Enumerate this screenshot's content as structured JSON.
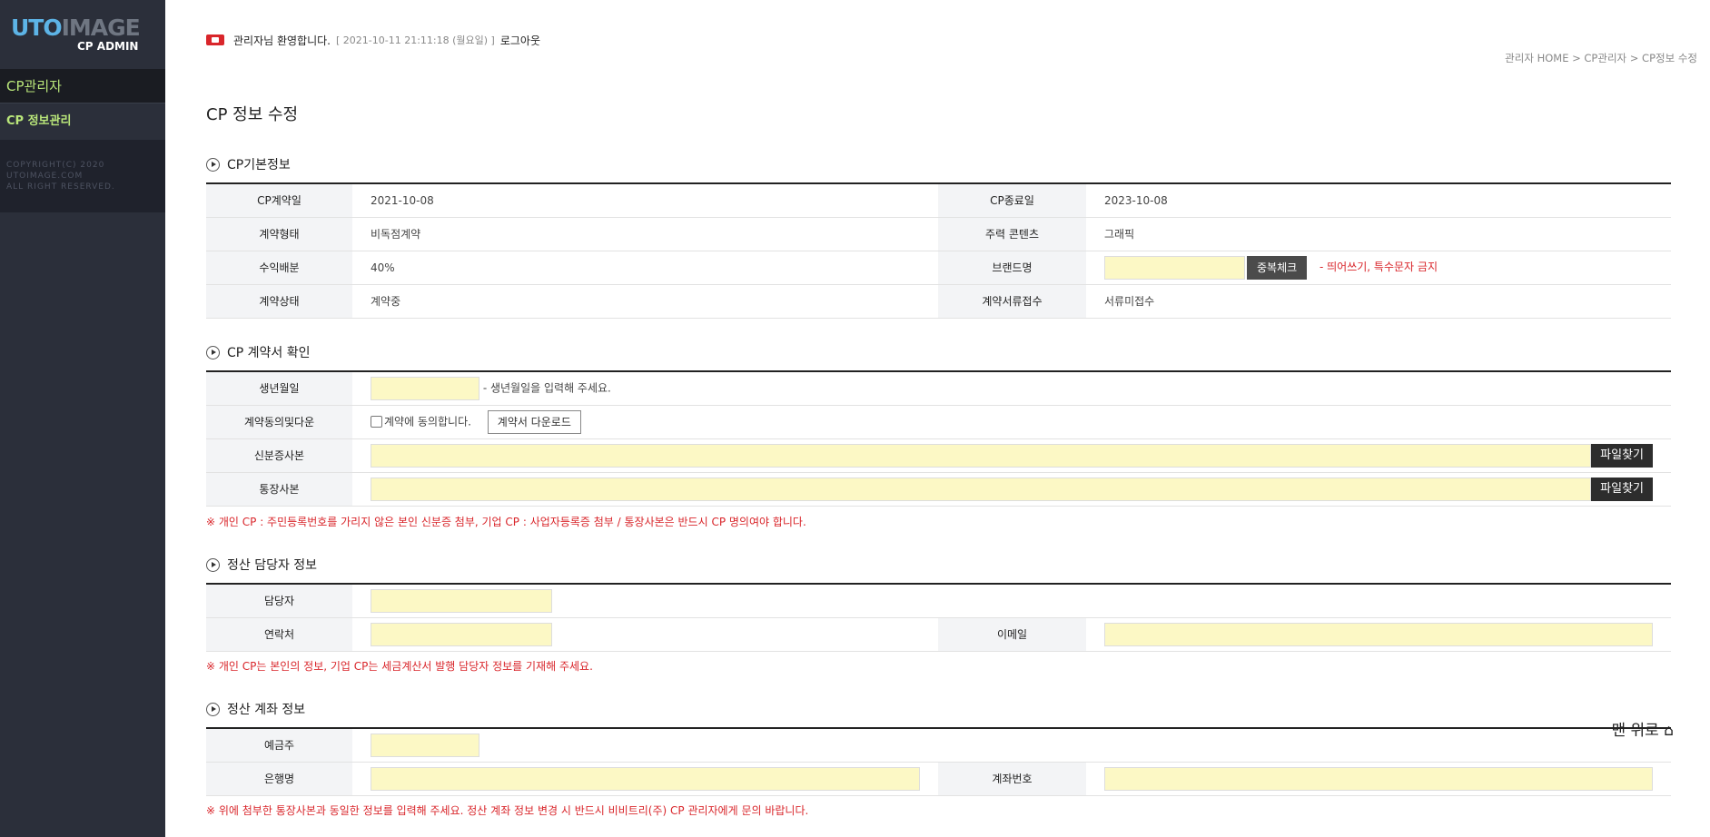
{
  "sidebar": {
    "logo_uto": "UTO",
    "logo_image": "IMAGE",
    "logo_sub": "CP ADMIN",
    "menu_head": "CP관리자",
    "menu_item": "CP 정보관리",
    "copyright_1": "COPYRIGHT(C) 2020",
    "copyright_2": "UTOIMAGE.COM",
    "copyright_3": "ALL RIGHT RESERVED."
  },
  "header": {
    "welcome": "관리자님 환영합니다.",
    "datetime": "[ 2021-10-11 21:11:18 (월요일) ]",
    "logout": "로그아웃",
    "breadcrumb": "관리자 HOME > CP관리자 > CP정보 수정",
    "page_title": "CP 정보 수정"
  },
  "basic": {
    "title": "CP기본정보",
    "contract_date_label": "CP계약일",
    "contract_date": "2021-10-08",
    "end_date_label": "CP종료일",
    "end_date": "2023-10-08",
    "contract_type_label": "계약형태",
    "contract_type": "비독점계약",
    "main_content_label": "주력 콘텐츠",
    "main_content": "그래픽",
    "revenue_label": "수익배분",
    "revenue": "40%",
    "brand_label": "브랜드명",
    "brand_value": "",
    "dup_check": "중복체크",
    "brand_note": "- 띄어쓰기, 특수문자 금지",
    "status_label": "계약상태",
    "status": "계약중",
    "docs_label": "계약서류접수",
    "docs_status": "서류미접수"
  },
  "contract": {
    "title": "CP 계약서 확인",
    "birth_label": "생년월일",
    "birth_value": "",
    "birth_hint": "- 생년월일을 입력해 주세요.",
    "agree_label": "계약동의및다운",
    "agree_text": "계약에 동의합니다.",
    "download_btn": "계약서 다운로드",
    "id_copy_label": "신분증사본",
    "bank_copy_label": "통장사본",
    "find_file": "파일찾기",
    "note": "※ 개인 CP : 주민등록번호를 가리지 않은 본인 신분증 첨부, 기업 CP : 사업자등록증 첨부 / 통장사본은 반드시 CP 명의여야 합니다."
  },
  "manager": {
    "title": "정산 담당자 정보",
    "name_label": "담당자",
    "phone_label": "연락처",
    "email_label": "이메일",
    "note": "※ 개인 CP는 본인의 정보, 기업 CP는 세금계산서 발행 담당자 정보를 기재해 주세요."
  },
  "account": {
    "title": "정산 계좌 정보",
    "holder_label": "예금주",
    "bank_label": "은행명",
    "number_label": "계좌번호",
    "note": "※ 위에 첨부한 통장사본과 동일한 정보를 입력해 주세요. 정산 계좌 정보 변경 시 반드시 비비트리(주) CP 관리자에게 문의 바랍니다."
  },
  "to_top": "맨 위로 ⌂",
  "colors": {
    "sidebar_bg": "#2b2f3a",
    "accent_green": "#b9e67a",
    "warning_red": "#d9262b",
    "input_yellow": "#fcf8c5"
  }
}
